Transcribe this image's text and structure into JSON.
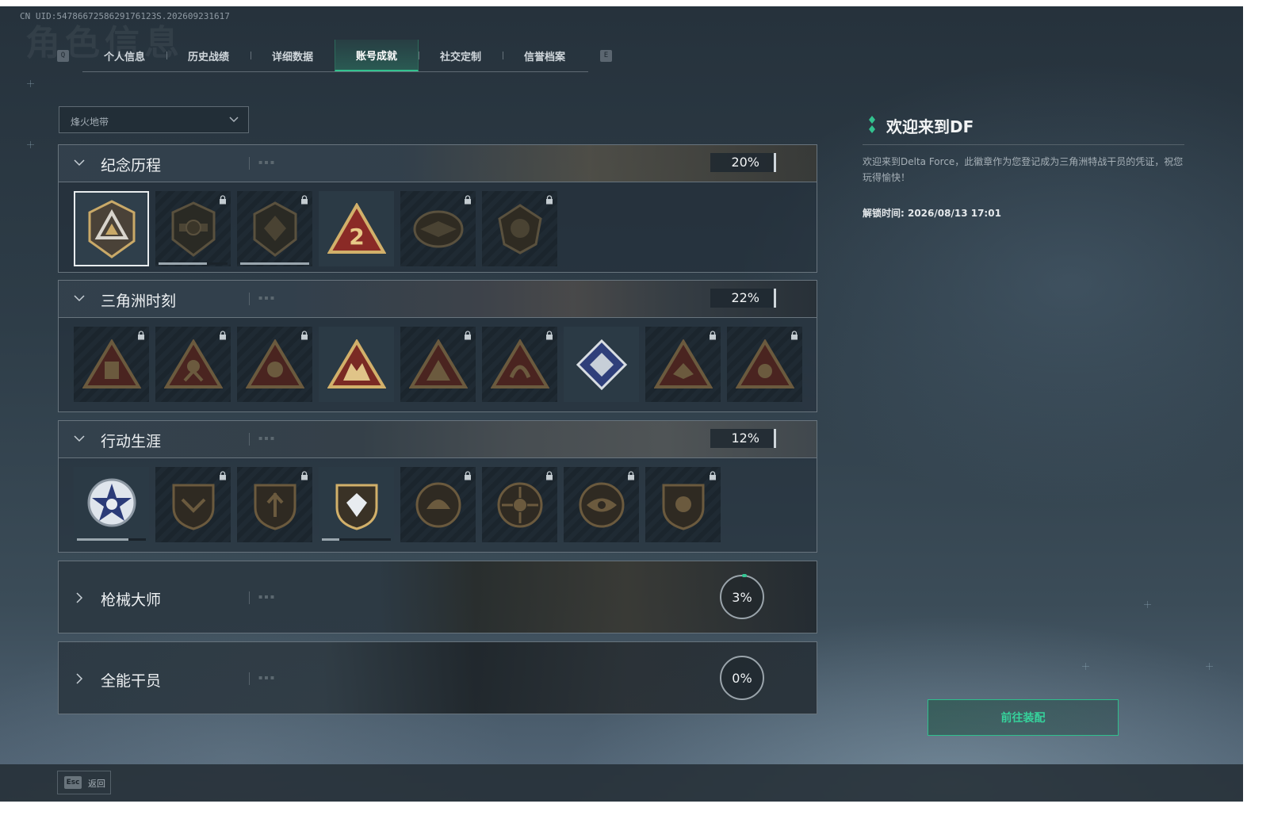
{
  "uid_text": "CN UID:5478667258629176123S.202609231617",
  "ghost_title": "角色信息",
  "tab_key_left": "Q",
  "tab_key_right": "E",
  "tabs": [
    {
      "label": "个人信息",
      "active": false
    },
    {
      "label": "历史战绩",
      "active": false
    },
    {
      "label": "详细数据",
      "active": false
    },
    {
      "label": "账号成就",
      "active": true
    },
    {
      "label": "社交定制",
      "active": false
    },
    {
      "label": "信誉档案",
      "active": false
    }
  ],
  "dropdown": {
    "value": "烽火地带"
  },
  "sections": [
    {
      "title": "纪念历程",
      "percent": "20%",
      "expanded": true,
      "medals": [
        {
          "icon": "triangle-shield-medal",
          "locked": false,
          "selected": true
        },
        {
          "icon": "helicopter-shield-medal",
          "locked": true,
          "progress": 0.7
        },
        {
          "icon": "hex-shield-medal",
          "locked": true,
          "progress": 1.0
        },
        {
          "icon": "red-triangle-medal",
          "locked": false
        },
        {
          "icon": "winged-emblem-medal",
          "locked": true
        },
        {
          "icon": "crest-emblem-medal",
          "locked": true
        }
      ]
    },
    {
      "title": "三角洲时刻",
      "percent": "22%",
      "expanded": true,
      "medals": [
        {
          "icon": "triangle-soldier-medal",
          "locked": true
        },
        {
          "icon": "triangle-runner-medal",
          "locked": true
        },
        {
          "icon": "triangle-skull-medal",
          "locked": true
        },
        {
          "icon": "triangle-squad-medal",
          "locked": false
        },
        {
          "icon": "triangle-fighter-medal",
          "locked": true
        },
        {
          "icon": "triangle-snake-medal",
          "locked": true
        },
        {
          "icon": "diamond-crest-medal",
          "locked": false
        },
        {
          "icon": "triangle-eagle-medal",
          "locked": true
        },
        {
          "icon": "triangle-beast-medal",
          "locked": true
        }
      ]
    },
    {
      "title": "行动生涯",
      "percent": "12%",
      "expanded": true,
      "medals": [
        {
          "icon": "star-badge-medal",
          "locked": false,
          "progress": 0.75
        },
        {
          "icon": "shield-wings-medal",
          "locked": true
        },
        {
          "icon": "shield-arrow-medal",
          "locked": true
        },
        {
          "icon": "shield-gem-medal",
          "locked": false,
          "progress": 0.25
        },
        {
          "icon": "round-helmet-medal",
          "locked": true
        },
        {
          "icon": "round-target-medal",
          "locked": true
        },
        {
          "icon": "round-eye-medal",
          "locked": true
        },
        {
          "icon": "shield-beast-medal",
          "locked": true
        }
      ]
    },
    {
      "title": "枪械大师",
      "percent": "3%",
      "expanded": false
    },
    {
      "title": "全能干员",
      "percent": "0%",
      "expanded": false
    }
  ],
  "detail": {
    "title": "欢迎来到DF",
    "description": "欢迎来到Delta Force，此徽章作为您登记成为三角洲特战干员的凭证，祝您玩得愉快！",
    "unlock_time": "解锁时间: 2026/08/13 17:01",
    "button_label": "前往装配"
  },
  "footer": {
    "key": "Esc",
    "label": "返回"
  },
  "colors": {
    "accent": "#33c28f",
    "gold": "#c9a968",
    "red": "#8a2a26"
  }
}
